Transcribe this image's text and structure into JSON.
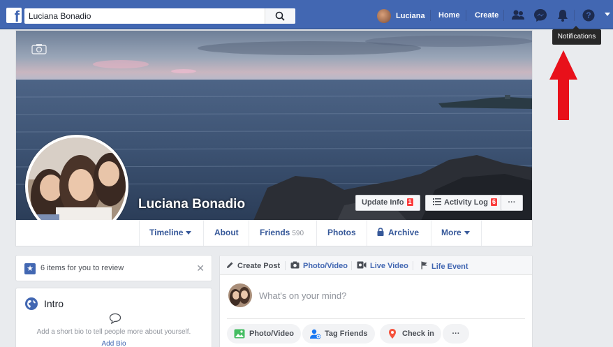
{
  "search": {
    "value": "Luciana Bonadio"
  },
  "nav": {
    "user_name": "Luciana",
    "home": "Home",
    "create": "Create"
  },
  "tooltip": "Notifications",
  "profile": {
    "name": "Luciana Bonadio"
  },
  "cover_buttons": {
    "update_info": "Update Info",
    "update_info_badge": "1",
    "activity_log": "Activity Log",
    "activity_log_badge": "6",
    "more": "···"
  },
  "tabs": [
    {
      "label": "Timeline"
    },
    {
      "label": "About"
    },
    {
      "label": "Friends",
      "count": "590"
    },
    {
      "label": "Photos"
    },
    {
      "label": "Archive"
    },
    {
      "label": "More"
    }
  ],
  "review": {
    "text": "6 items for you to review"
  },
  "intro": {
    "title": "Intro",
    "text": "Add a short bio to tell people more about yourself.",
    "link": "Add Bio"
  },
  "composer": {
    "create_post": "Create Post",
    "photo_video": "Photo/Video",
    "live_video": "Live Video",
    "life_event": "Life Event",
    "placeholder": "What's on your mind?",
    "actions": {
      "photo_video": "Photo/Video",
      "tag_friends": "Tag Friends",
      "check_in": "Check in",
      "more": "···"
    }
  },
  "colors": {
    "brand": "#4267b2",
    "badge": "#fa3e3e",
    "arrow": "#e8101a"
  }
}
